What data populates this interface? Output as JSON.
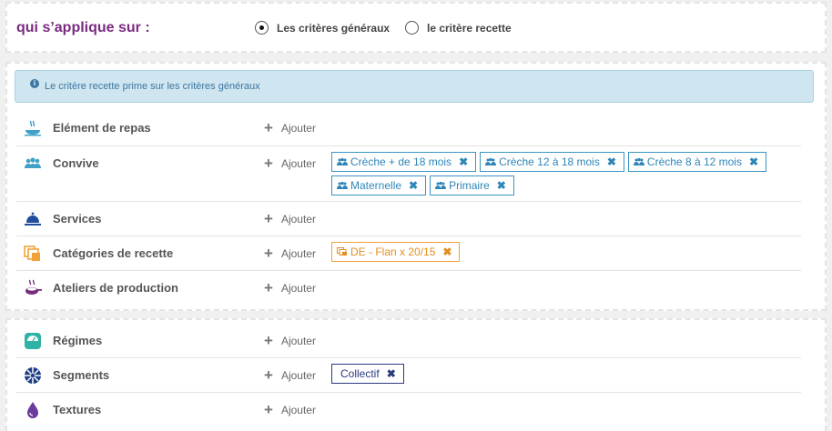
{
  "scope": {
    "question": "qui s’applique sur :",
    "options": [
      {
        "label": "Les critères généraux",
        "checked": true
      },
      {
        "label": "le critère recette",
        "checked": false
      }
    ]
  },
  "info": {
    "icon": "info-icon",
    "message": "Le critère recette prime sur les critères généraux"
  },
  "add_label": "Ajouter",
  "criteria": [
    {
      "label": "Elément de repas",
      "icon": "dish-icon",
      "tags": []
    },
    {
      "label": "Convive",
      "icon": "people-icon",
      "tags": [
        {
          "label": "Crèche + de 18 mois",
          "icon": "people-icon"
        },
        {
          "label": "Crèche 12 à 18 mois",
          "icon": "people-icon"
        },
        {
          "label": "Crèche 8 à 12 mois",
          "icon": "people-icon"
        },
        {
          "label": "Maternelle",
          "icon": "people-icon"
        },
        {
          "label": "Primaire",
          "icon": "people-icon"
        }
      ]
    },
    {
      "label": "Services",
      "icon": "cloche-icon",
      "tags": []
    },
    {
      "label": "Catégories de recette",
      "icon": "stack-icon",
      "tags": [
        {
          "label": "DE - Flan x 20/15",
          "icon": "stack-icon"
        }
      ]
    },
    {
      "label": "Ateliers de production",
      "icon": "pot-icon",
      "tags": []
    },
    {
      "label": "Régimes",
      "icon": "scale-icon",
      "tags": []
    },
    {
      "label": "Segments",
      "icon": "aperture-icon",
      "tags": [
        {
          "label": "Collectif"
        }
      ]
    },
    {
      "label": "Textures",
      "icon": "drop-icon",
      "tags": []
    }
  ],
  "colors": {
    "question": "#7a2b80",
    "tag_blue": "#2e86b8",
    "tag_orange": "#e38d1e",
    "tag_navy": "#2a3b7e",
    "info_bg": "#cfe5ef"
  }
}
